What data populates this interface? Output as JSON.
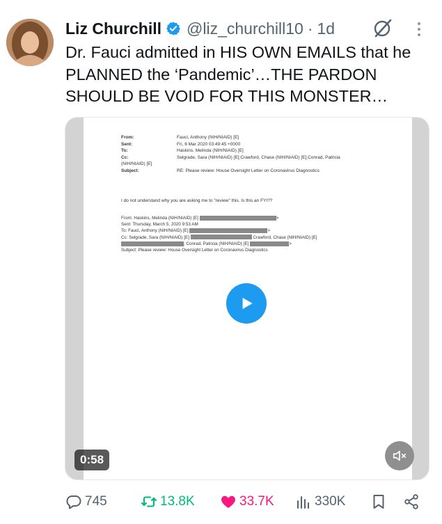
{
  "author": {
    "name": "Liz Churchill",
    "handle": "@liz_churchill10",
    "separator": "·",
    "time": "1d"
  },
  "icons": {
    "verified": "verified-badge-icon",
    "grok": "grok-icon",
    "more": "more-vertical-icon",
    "reply": "reply-icon",
    "retweet": "retweet-icon",
    "like": "heart-icon",
    "views": "views-icon",
    "bookmark": "bookmark-icon",
    "share": "share-icon",
    "play": "play-icon",
    "mute": "mute-icon"
  },
  "tweet": {
    "text": "Dr. Fauci admitted in HIS OWN EMAILS that he PLANNED the ‘Pandemic’…THE PARDON SHOULD BE VOID FOR THIS MONSTER…"
  },
  "media": {
    "duration": "0:58",
    "email": {
      "rows": [
        {
          "label": "From:",
          "value": "Fauci, Anthony (NIH/NIAID) [E]"
        },
        {
          "label": "Sent:",
          "value": "Fri, 6 Mar 2020 03:49:45 +0000"
        },
        {
          "label": "To:",
          "value": "Haskins, Melinda (NIH/NIAID) [E]"
        },
        {
          "label": "Cc:",
          "value": "Selgrade, Sara (NIH/NIAID) [E];Crawford, Chase (NIH/NIAID) [E];Conrad, Patricia"
        },
        {
          "label": "(NIH/NIAID) [E]",
          "value": ""
        },
        {
          "label": "Subject:",
          "value": "RE: Please review: House Oversight Letter on Coronavirus Diagnostics"
        }
      ],
      "body": "I do not understand why you are asking me to \"review\" this.  Is this an FYI??",
      "forward": {
        "from": "From: Haskins, Melinda (NIH/NIAID) [E]",
        "sent": "Sent: Thursday, March 5, 2020 9:53 AM",
        "to": "To: Fauci, Anthony (NIH/NIAID) [E]",
        "cc": "Cc: Selgrade, Sara (NIH/NIAID) [E]",
        "cc_crawford": "Crawford, Chase (NIH/NIAID) [E]",
        "cc_conrad": "; Conrad, Patricia (NIH/NIAID) [E]",
        "subject": "Subject: Please review: House Oversight Letter on Coronavirus Diagnostics"
      }
    }
  },
  "stats": {
    "replies": "745",
    "retweets": "13.8K",
    "likes": "33.7K",
    "views": "330K"
  },
  "colors": {
    "verified": "#1d9bf0",
    "retweet": "#00ba7c",
    "like": "#f91880",
    "muted_text": "#536471",
    "play": "#1d9bf0"
  }
}
